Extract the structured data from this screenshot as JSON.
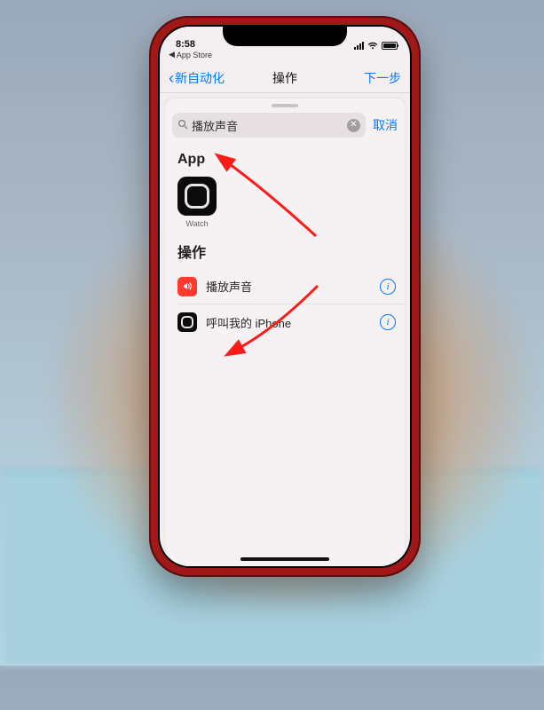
{
  "status": {
    "time": "8:58",
    "breadcrumb": "App Store"
  },
  "nav": {
    "back": "新自动化",
    "title": "操作",
    "next": "下一步"
  },
  "search": {
    "value": "播放声音",
    "cancel": "取消"
  },
  "sections": {
    "apps_title": "App",
    "apps": [
      {
        "label": "Watch"
      }
    ],
    "actions_title": "操作",
    "actions": [
      {
        "label": "播放声音",
        "icon": "speaker"
      },
      {
        "label": "呼叫我的 iPhone",
        "icon": "watch"
      }
    ]
  }
}
